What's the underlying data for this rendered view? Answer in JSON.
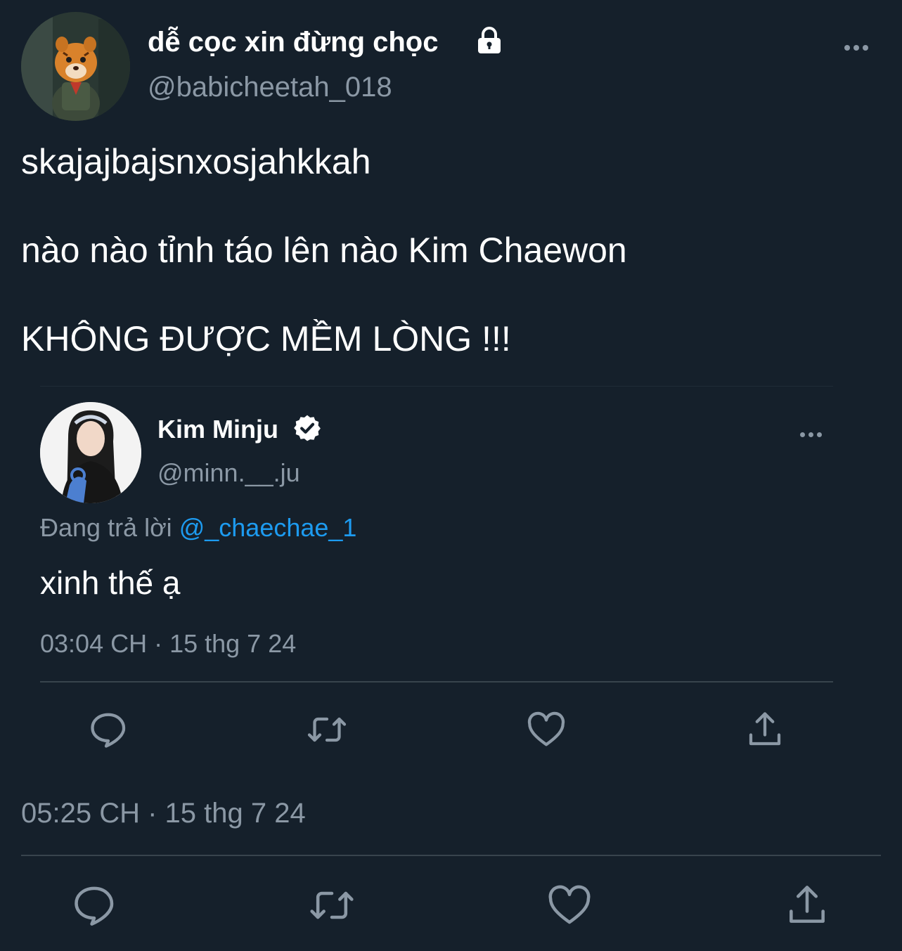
{
  "tweet": {
    "display_name": "dễ cọc xin đừng chọc",
    "protected_icon": "lock-icon",
    "handle": "@babicheetah_018",
    "avatar_icon": "cartoon-tiger-avatar",
    "more_icon": "more-horizontal-icon",
    "text_lines": [
      "skajajbajsnxosjahkkah",
      "nào nào tỉnh táo lên nào Kim Chaewon",
      "KHÔNG ĐƯỢC MỀM LÒNG !!!"
    ],
    "timestamp": "05:25 CH · 15 thg 7 24",
    "actions": [
      "reply-icon",
      "retweet-icon",
      "like-icon",
      "share-icon"
    ]
  },
  "quoted": {
    "display_name": "Kim Minju",
    "verified_icon": "verified-badge-icon",
    "handle": "@minn.__.ju",
    "avatar_icon": "profile-photo-avatar",
    "more_icon": "more-horizontal-icon",
    "replying_prefix": "Đang trả lời",
    "replying_to": "@_chaechae_1",
    "text": "xinh thế ạ",
    "timestamp": "03:04 CH · 15 thg 7 24",
    "actions": [
      "reply-icon",
      "retweet-icon",
      "like-icon",
      "share-icon"
    ]
  },
  "colors": {
    "background": "#15202b",
    "text": "#ffffff",
    "secondary": "#8b98a5",
    "link": "#1d9bf0",
    "divider": "#38444d"
  }
}
